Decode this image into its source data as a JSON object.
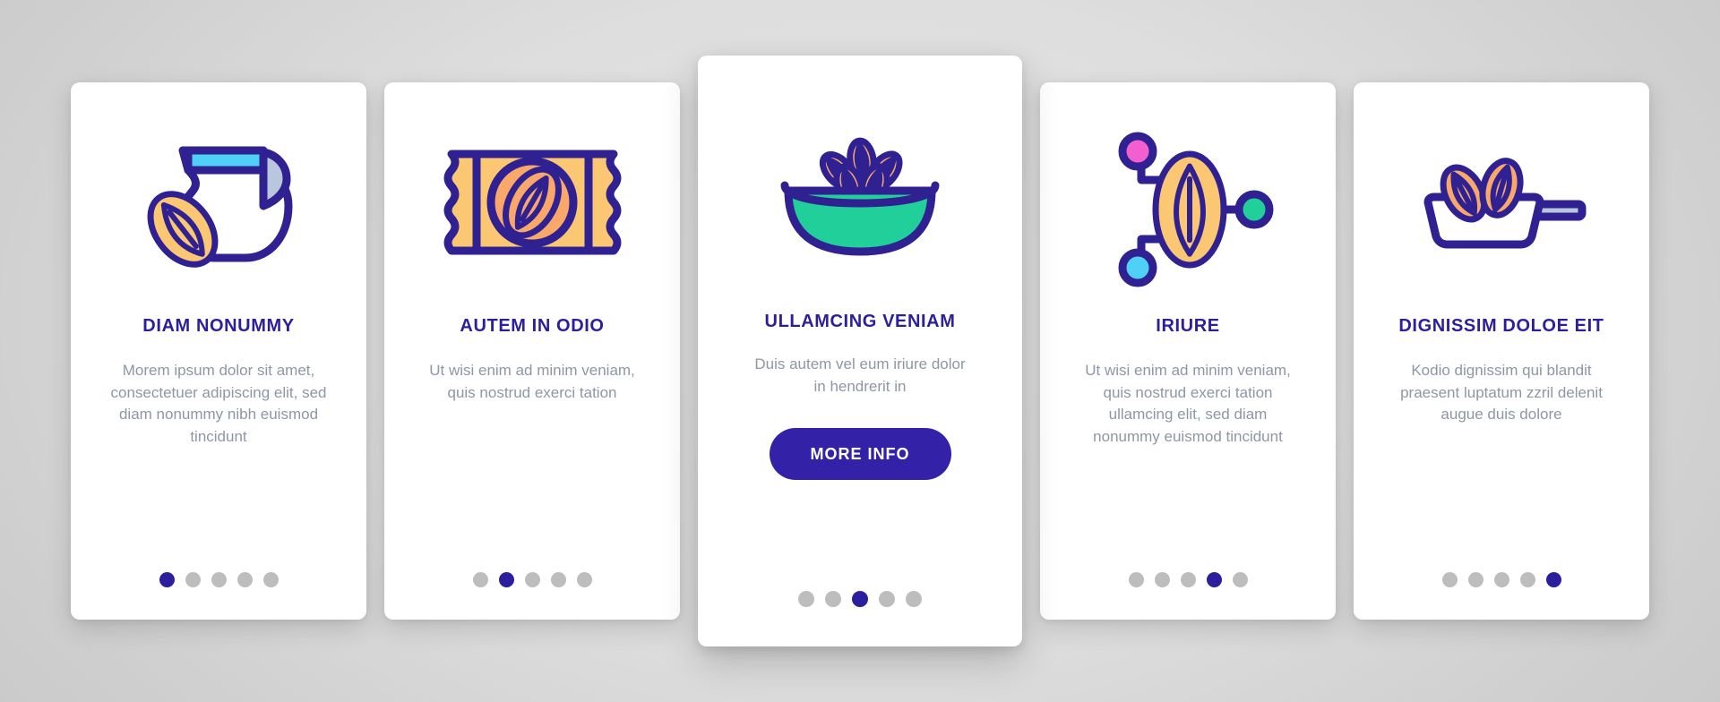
{
  "theme": {
    "background": "#dcdcdc",
    "card_bg": "#ffffff",
    "title_color": "#2b1f9e",
    "body_color": "#8d97a5",
    "accent": "#3322a8",
    "dot_inactive": "#bdbdbd",
    "dot_active": "#2b1f9e",
    "icon_outline": "#2f2192",
    "icon_orange": "#f9a86a",
    "icon_amber": "#fbc772",
    "icon_cyan": "#4fd0f7",
    "icon_steel": "#b9c6dd",
    "icon_green": "#21cf9a",
    "icon_pink": "#f45fd0"
  },
  "cards": [
    {
      "id": "card-1",
      "icon": "almond-pitcher-icon",
      "title": "DIAM NONUMMY",
      "body": "Morem ipsum dolor sit amet, consectetuer adipiscing elit, sed diam nonummy nibh euismod tincidunt",
      "featured": false,
      "cta": null,
      "dots_total": 5,
      "dot_active_index": 0
    },
    {
      "id": "card-2",
      "icon": "almond-candy-wrapper-icon",
      "title": "AUTEM IN ODIO",
      "body": "Ut wisi enim ad minim veniam, quis nostrud exerci tation",
      "featured": false,
      "cta": null,
      "dots_total": 5,
      "dot_active_index": 1
    },
    {
      "id": "card-3",
      "icon": "almond-bowl-icon",
      "title": "ULLAMCING VENIAM",
      "body": "Duis autem vel eum iriure dolor in hendrerit in",
      "featured": true,
      "cta": "MORE INFO",
      "dots_total": 5,
      "dot_active_index": 2
    },
    {
      "id": "card-4",
      "icon": "almond-network-icon",
      "title": "IRIURE",
      "body": "Ut wisi enim ad minim veniam, quis nostrud exerci tation ullamcing elit, sed diam nonummy euismod tincidunt",
      "featured": false,
      "cta": null,
      "dots_total": 5,
      "dot_active_index": 3
    },
    {
      "id": "card-5",
      "icon": "almond-pan-icon",
      "title": "DIGNISSIM DOLOE EIT",
      "body": "Kodio dignissim qui blandit praesent luptatum zzril delenit augue duis dolore",
      "featured": false,
      "cta": null,
      "dots_total": 5,
      "dot_active_index": 4
    }
  ]
}
